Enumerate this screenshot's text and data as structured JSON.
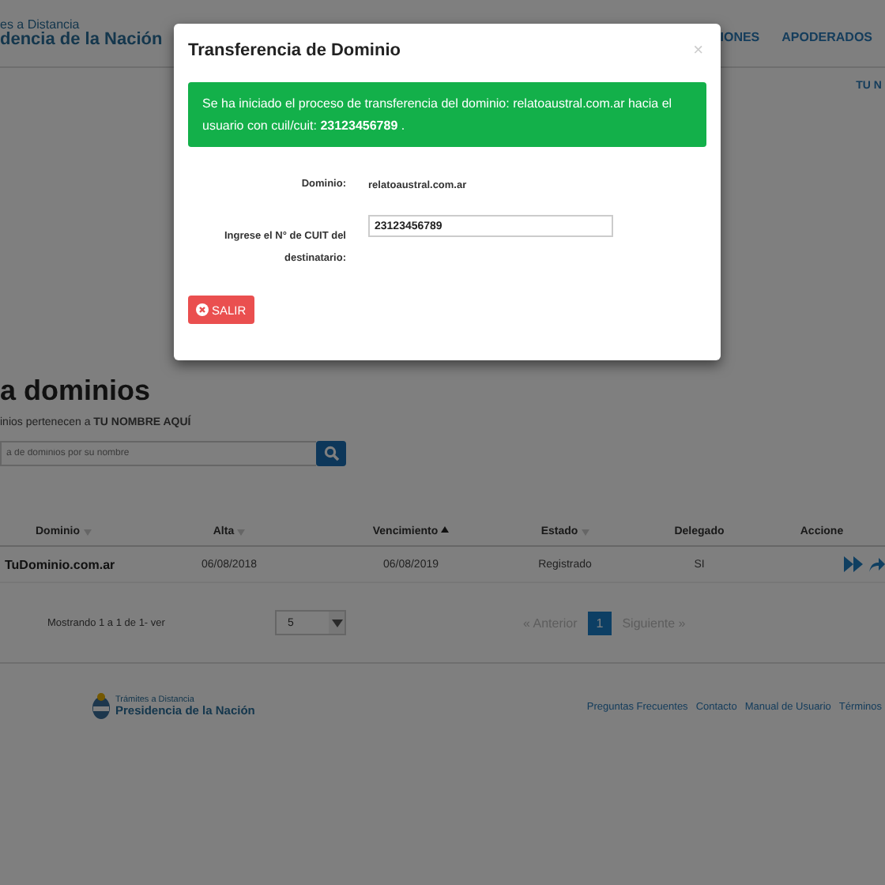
{
  "header": {
    "brand_top": "es a Distancia",
    "brand_bottom": "dencia de la Nación",
    "nav": [
      "IONES",
      "APODERADOS"
    ],
    "user": "TU N"
  },
  "page": {
    "title": "a dominios",
    "subtitle": "inios pertenecen a **TU NOMBRE AQUÍ**",
    "search": {
      "placeholder": "a de dominios por su nombre"
    }
  },
  "table": {
    "columns": [
      {
        "label": "Dominio",
        "sorted": false
      },
      {
        "label": "Alta",
        "sorted": false
      },
      {
        "label": "Vencimiento",
        "sorted": true
      },
      {
        "label": "Estado",
        "sorted": false
      },
      {
        "label": "Delegado"
      },
      {
        "label": "Accione"
      }
    ],
    "rows": [
      {
        "cells": [
          "TuDominio.com.ar",
          "06/08/2018",
          "06/08/2019",
          "Registrado",
          "SI"
        ]
      }
    ]
  },
  "footer_table": {
    "info": "Mostrando 1 a 1 de 1- ver",
    "page_size": "5",
    "pages": [
      {
        "label": "« Anterior",
        "kind": "prev",
        "disabled": true,
        "selected": false
      },
      {
        "label": "1",
        "kind": "page",
        "disabled": false,
        "selected": true
      },
      {
        "label": "Siguiente »",
        "kind": "next",
        "disabled": true,
        "selected": false
      }
    ]
  },
  "footer": {
    "brand_top": "Trámites a Distancia",
    "brand_bottom": "Presidencia de la Nación",
    "links": [
      "Preguntas Frecuentes",
      "Contacto",
      "Manual de Usuario",
      "Términos"
    ]
  },
  "modal": {
    "title": "Transferencia de Dominio",
    "close": "×",
    "alert": "Se ha iniciado el proceso de transferencia del dominio: relatoaustral.com.ar hacia el usuario con cuil/cuit: **23123456789** .",
    "fields": [
      {
        "label": "Dominio:",
        "kind": "text",
        "value": "relatoaustral.com.ar"
      },
      {
        "label": "Ingrese el N° de CUIT del destinatario:",
        "kind": "input",
        "value": "23123456789"
      }
    ],
    "button": "SALIR"
  }
}
